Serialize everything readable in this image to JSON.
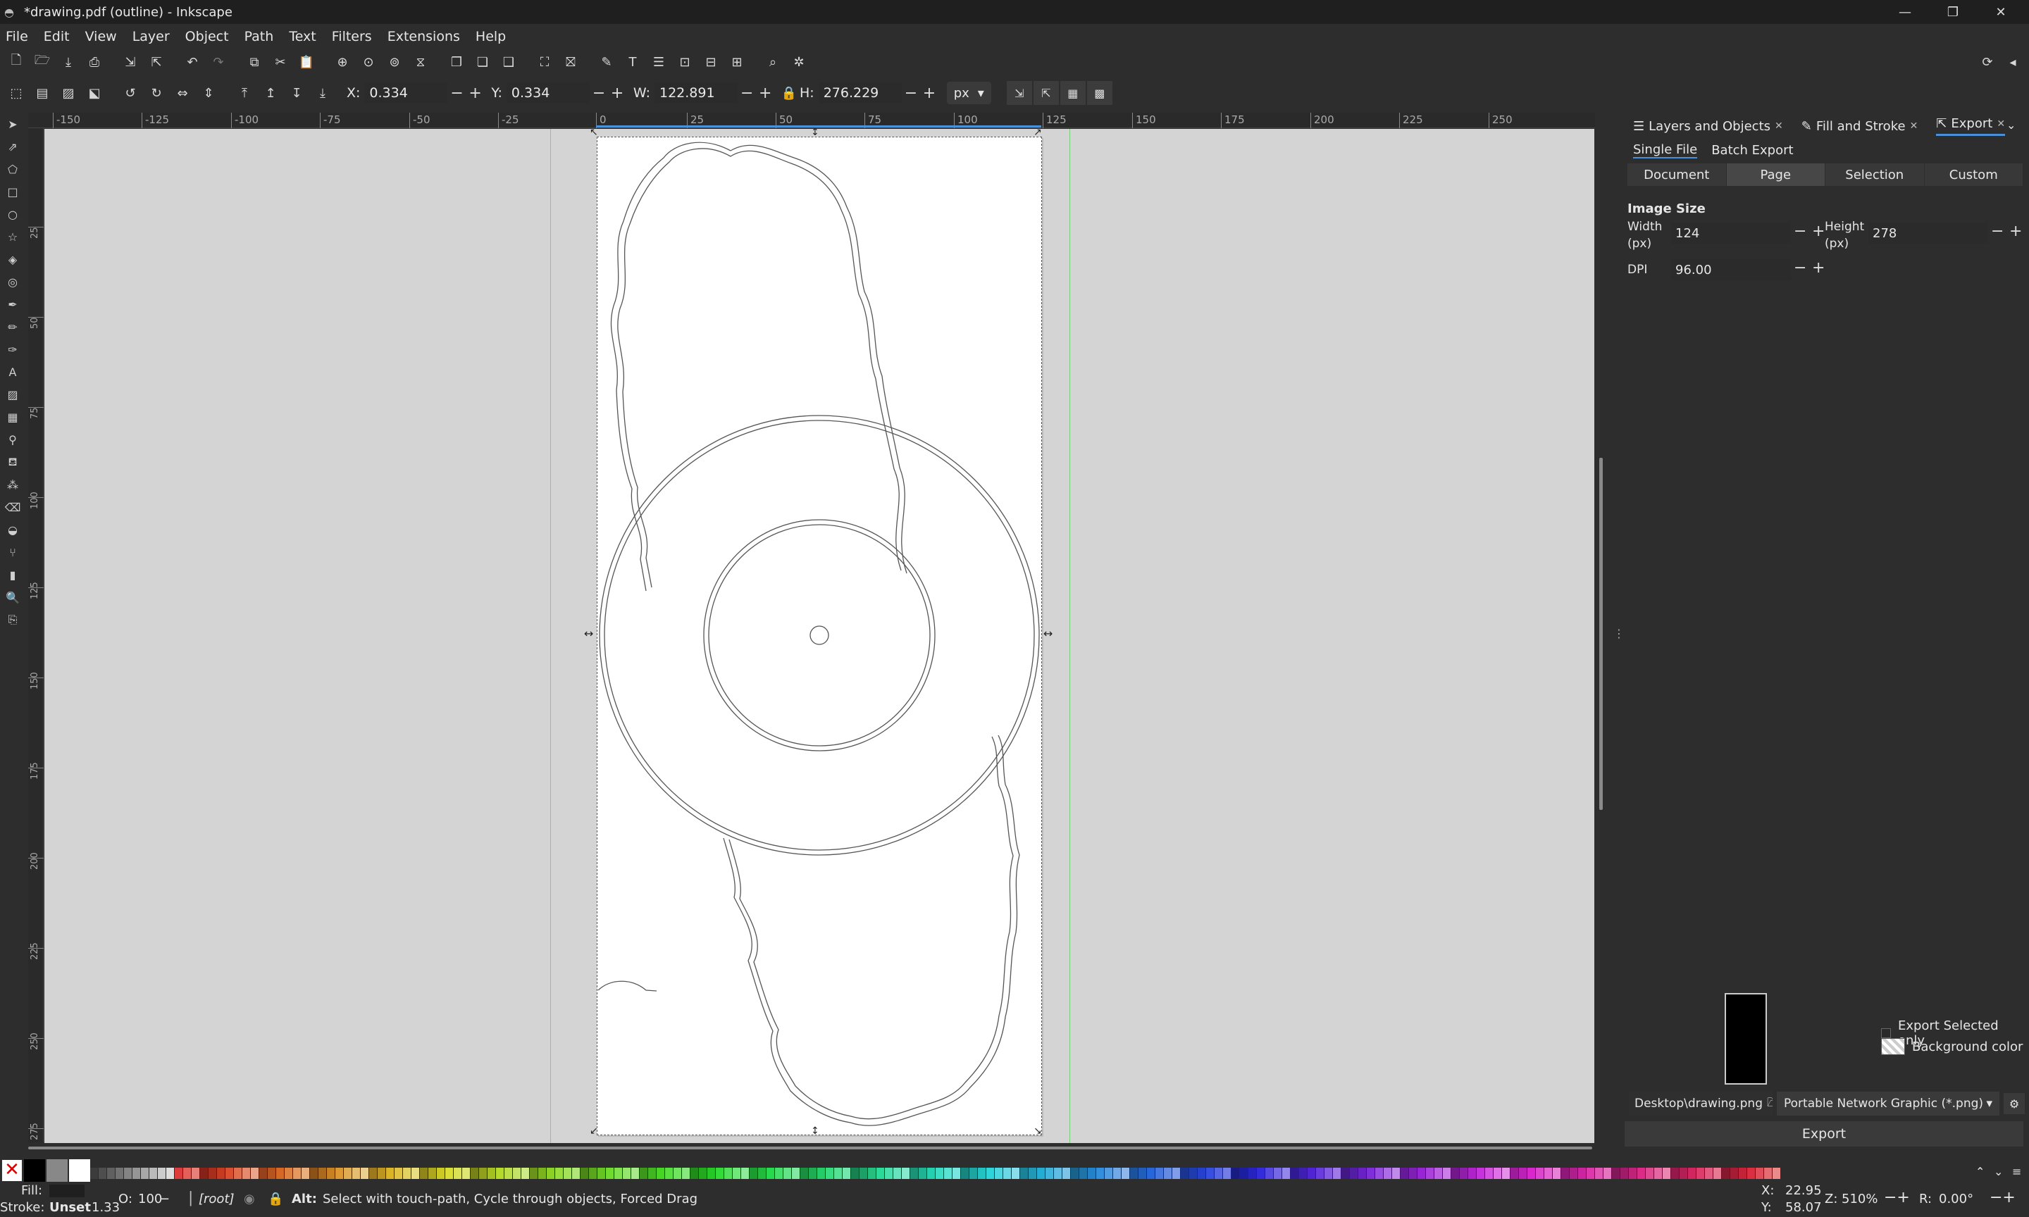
{
  "window": {
    "title": "*drawing.pdf (outline) - Inkscape",
    "controls": {
      "minimize": "—",
      "maximize": "❐",
      "close": "✕"
    }
  },
  "menu": [
    "File",
    "Edit",
    "View",
    "Layer",
    "Object",
    "Path",
    "Text",
    "Filters",
    "Extensions",
    "Help"
  ],
  "toolcontrols": {
    "x_label": "X:",
    "x": "0.334",
    "y_label": "Y:",
    "y": "0.334",
    "w_label": "W:",
    "w": "122.891",
    "h_label": "H:",
    "h": "276.229",
    "unit": "px"
  },
  "ruler": {
    "h_labels": [
      "-150",
      "-125",
      "-100",
      "-75",
      "-50",
      "-25",
      "0",
      "25",
      "50",
      "75",
      "100",
      "125",
      "150",
      "175",
      "200",
      "225",
      "250"
    ],
    "v_labels": [
      "25",
      "50",
      "75",
      "100",
      "125",
      "150",
      "175",
      "200",
      "225",
      "250",
      "275"
    ]
  },
  "dock": {
    "tabs": [
      {
        "label": "Layers and Objects",
        "icon": "layers-icon"
      },
      {
        "label": "Fill and Stroke",
        "icon": "brush-icon"
      },
      {
        "label": "Export",
        "icon": "export-icon"
      }
    ],
    "export_modes": [
      "Single File",
      "Batch Export"
    ],
    "areas": [
      "Document",
      "Page",
      "Selection",
      "Custom"
    ],
    "image_size_title": "Image Size",
    "width_label": "Width\n(px)",
    "width": "124",
    "height_label": "Height\n(px)",
    "height": "278",
    "dpi_label": "DPI",
    "dpi": "96.00",
    "export_selected_only": "Export Selected only",
    "background_color": "Background color",
    "filename": "Desktop\\drawing.png",
    "format": "Portable Network Graphic (*.png)",
    "export_button": "Export"
  },
  "status": {
    "fill_label": "Fill:",
    "stroke_label": "Stroke:",
    "stroke_value": "Unset",
    "stroke_width": "1.33",
    "opacity_label": "O:",
    "opacity": "100",
    "layer": "[root]",
    "hint_bold": "Alt:",
    "hint": "Select with touch-path, Cycle through objects, Forced Drag",
    "cursor_x_label": "X:",
    "cursor_x": "22.95",
    "cursor_y_label": "Y:",
    "cursor_y": "58.07",
    "zoom_label": "Z:",
    "zoom": "510%",
    "rotation_label": "R:",
    "rotation": "0.00°"
  },
  "colors": {
    "accent": "#4a90d9",
    "canvas_bg": "#d4d4d4",
    "page": "#ffffff",
    "ui_bg": "#2d2d2d"
  }
}
